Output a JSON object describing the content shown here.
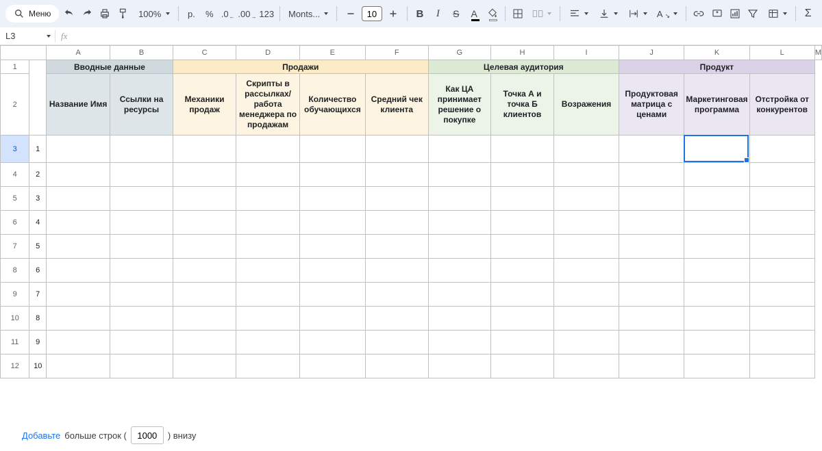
{
  "toolbar": {
    "menu": "Меню",
    "zoom": "100%",
    "currency": "р.",
    "percent": "%",
    "decDec": ".0",
    "incDec": ".00",
    "numFmt": "123",
    "fontName": "Monts...",
    "fontSize": "10"
  },
  "nameBox": "L3",
  "fxLabel": "fx",
  "columns": [
    "A",
    "B",
    "C",
    "D",
    "E",
    "F",
    "G",
    "H",
    "I",
    "J",
    "K",
    "L",
    "M"
  ],
  "numLabels": [
    "1",
    "2",
    "3",
    "4",
    "5",
    "6",
    "7",
    "8",
    "9",
    "10"
  ],
  "rowNumbers": [
    "1",
    "2",
    "3",
    "4",
    "5",
    "6",
    "7",
    "8",
    "9",
    "10",
    "11",
    "12"
  ],
  "groupHeaders": {
    "intro": "Вводные данные",
    "sales": "Продажи",
    "audience": "Целевая аудитория",
    "product": "Продукт"
  },
  "subHeaders": {
    "b": "Название Имя",
    "c": "Ссылки на ресурсы",
    "d": "Механики продаж",
    "e": "Скрипты в рассылках/работа менеджера по продажам",
    "f": "Количество обучающихся",
    "g": "Средний чек клиента",
    "h": "Как ЦА принимает решение о покупке",
    "i": "Точка А и точка Б клиентов",
    "j": "Возражения",
    "k": "Продуктовая матрица с ценами",
    "l": "Маркетинговая программа",
    "m": "Отстройка от конкурентов"
  },
  "addRows": {
    "link": "Добавьте",
    "before": "больше строк (",
    "count": "1000",
    "after": ") внизу"
  },
  "selectedCell": "L3"
}
